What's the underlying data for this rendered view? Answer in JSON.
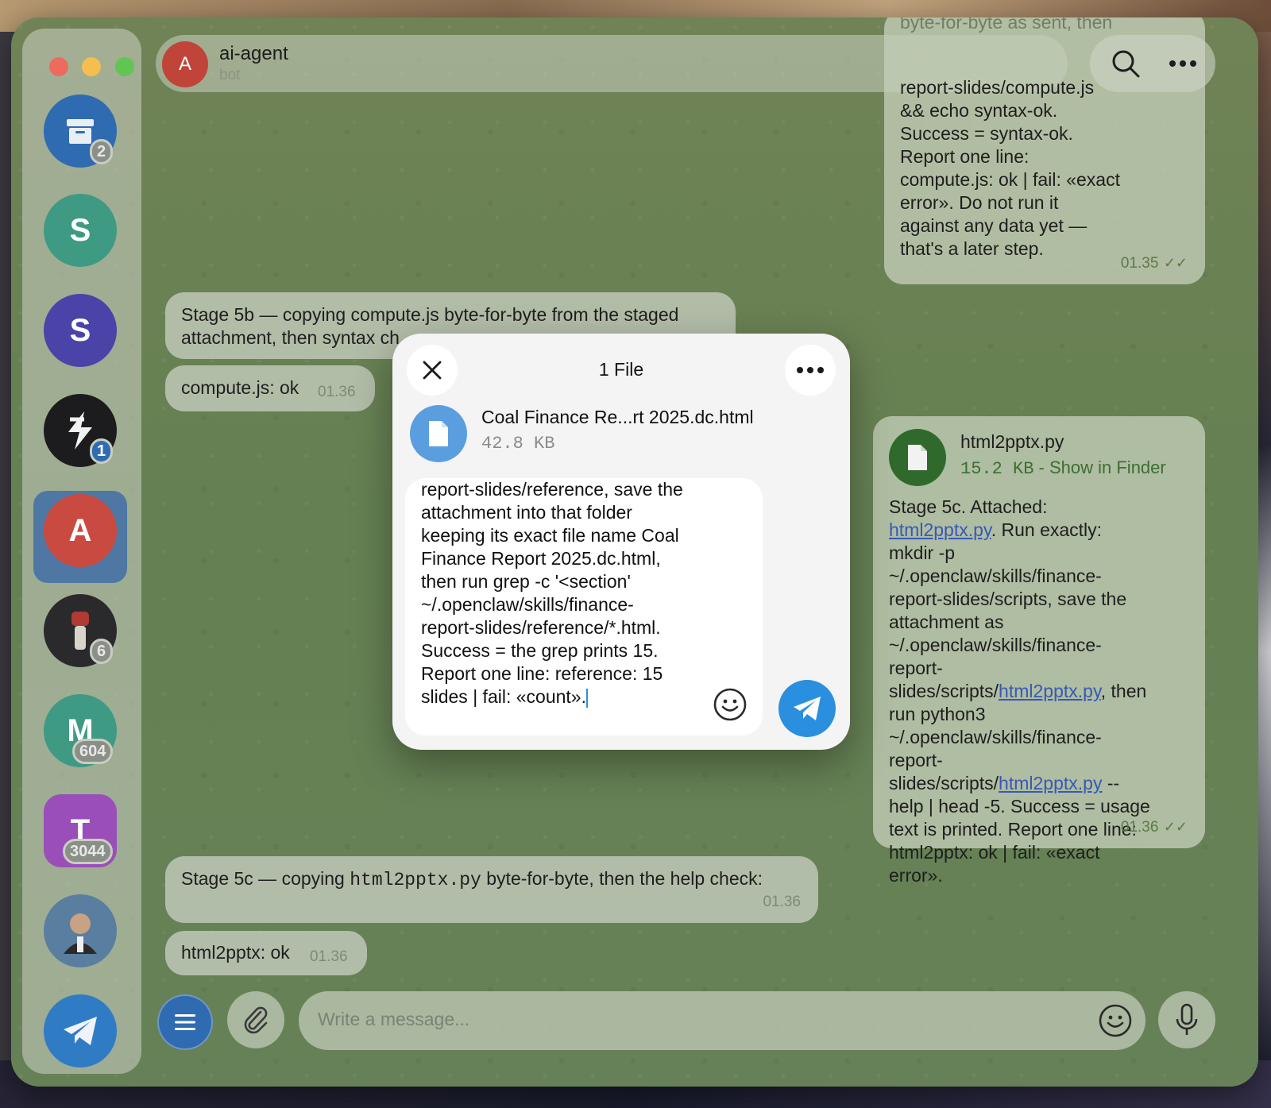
{
  "header": {
    "title": "ai-agent",
    "subtitle": "bot",
    "avatar_letter": "A"
  },
  "sidebar": {
    "items": [
      {
        "name": "archive",
        "badge": "2",
        "color": "#2f6bb0"
      },
      {
        "name": "chat-s-green",
        "letter": "S",
        "color": "#3f9a83"
      },
      {
        "name": "chat-s-purple",
        "letter": "S",
        "color": "#4a43a8"
      },
      {
        "name": "chat-dark",
        "badge": "1",
        "color": "#1c1c1e"
      },
      {
        "name": "chat-ai-agent",
        "letter": "A",
        "color": "#c94a40"
      },
      {
        "name": "chat-fist",
        "badge": "6",
        "color": "#2a2a2d"
      },
      {
        "name": "chat-m",
        "letter": "M",
        "badge": "604",
        "color": "#3f9a83"
      },
      {
        "name": "chat-t",
        "letter": "T",
        "badge": "3044",
        "color": "#9a4fb8"
      },
      {
        "name": "chat-photo",
        "color": "#5a7ea0"
      },
      {
        "name": "telegram-app",
        "color": "#2f7cc4"
      }
    ]
  },
  "messages": {
    "top_out": {
      "lines": [
        "byte-for-byte as sent, then",
        "report-slides/compute.js",
        "&& echo syntax-ok.",
        "Success = syntax-ok.",
        "Report one line:",
        "compute.js: ok | fail: «exact",
        "error». Do not run it",
        "against any data yet —",
        "that's a later step."
      ],
      "time": "01.35"
    },
    "stage5b": {
      "text": "Stage 5b — copying compute.js byte-for-byte from the staged attachment, then syntax ch"
    },
    "compute_ok": {
      "text": "compute.js: ok",
      "time": "01.36"
    },
    "html2pptx_out": {
      "file_name": "html2pptx.py",
      "file_size": "15.2 KB",
      "show_in_finder": "- Show in Finder",
      "text_parts": {
        "p1": "Stage 5c. Attached: ",
        "link": "html2pptx.py",
        "p2": ". Run exactly: mkdir -p ~/.openclaw/skills/finance-report-slides/scripts, save the attachment as ~/.openclaw/skills/finance-report-slides/scripts/",
        "p3": ", then run python3 ~/.openclaw/skills/finance-report-slides/scripts/",
        "p4": " --help | head -5. Success = usage text is printed. Report one line: html2pptx: ok | fail: «exact error»."
      },
      "time": "01.36"
    },
    "stage5c": {
      "pre": "Stage 5c — copying ",
      "code": "html2pptx.py",
      "post": " byte-for-byte, then the help check:",
      "time": "01.36"
    },
    "html2pptx_ok": {
      "text": "html2pptx: ok",
      "time": "01.36"
    }
  },
  "composer": {
    "placeholder": "Write a message..."
  },
  "modal": {
    "title": "1 File",
    "file_name": "Coal Finance Re...rt 2025.dc.html",
    "file_size": "42.8 KB",
    "caption": "report-slides/reference, save the attachment into that folder keeping its exact file name Coal Finance Report 2025.dc.html, then run grep -c '<section' ~/.openclaw/skills/finance-report-slides/reference/*.html. Success = the grep prints 15. Report one line: reference: 15 slides | fail: «count»."
  },
  "colors": {
    "accent": "#2a8fde",
    "out_accent": "#2f6a2c"
  }
}
